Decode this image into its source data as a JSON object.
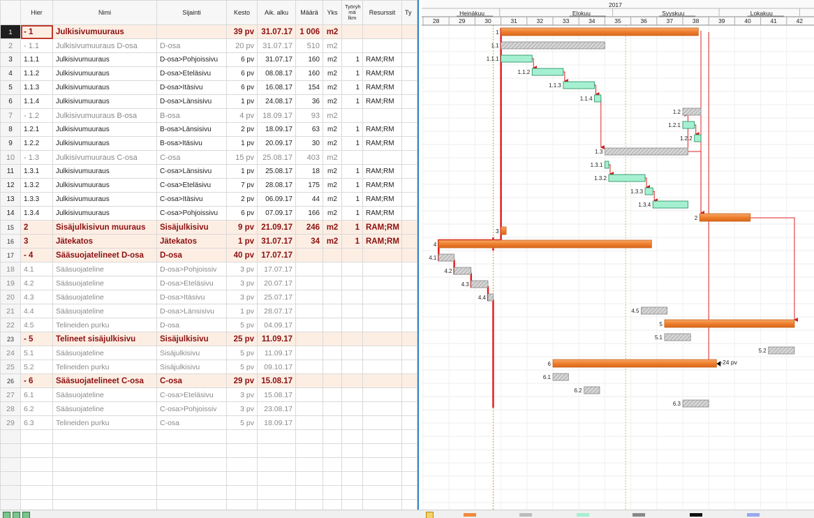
{
  "headers": {
    "hier": "Hier",
    "name": "Nimi",
    "location": "Sijainti",
    "duration": "Kesto",
    "start": "Aik. alku",
    "qty": "Määrä",
    "unit": "Yks",
    "crew": "Työryh\nmä\nlkm",
    "resources": "Resurssit",
    "type": "Ty"
  },
  "rows": [
    {
      "n": "1",
      "hier": "- 1",
      "name": "Julkisivumuuraus",
      "loc": "",
      "dur": "39 pv",
      "start": "31.07.17",
      "qty": "1 006",
      "unit": "m2",
      "crew": "",
      "res": "",
      "kind": "top",
      "sel": true
    },
    {
      "n": "2",
      "hier": "- 1.1",
      "name": "Julkisivumuuraus D-osa",
      "loc": "D-osa",
      "dur": "20 pv",
      "start": "31.07.17",
      "qty": "510",
      "unit": "m2",
      "crew": "",
      "res": "",
      "kind": "sum"
    },
    {
      "n": "3",
      "hier": "1.1.1",
      "name": "Julkisivumuuraus",
      "loc": "D-osa>Pohjoissivu",
      "dur": "6 pv",
      "start": "31.07.17",
      "qty": "160",
      "unit": "m2",
      "crew": "1",
      "res": "RAM;RM",
      "kind": "task"
    },
    {
      "n": "4",
      "hier": "1.1.2",
      "name": "Julkisivumuuraus",
      "loc": "D-osa>Eteläsivu",
      "dur": "6 pv",
      "start": "08.08.17",
      "qty": "160",
      "unit": "m2",
      "crew": "1",
      "res": "RAM;RM",
      "kind": "task"
    },
    {
      "n": "5",
      "hier": "1.1.3",
      "name": "Julkisivumuuraus",
      "loc": "D-osa>Itäsivu",
      "dur": "6 pv",
      "start": "16.08.17",
      "qty": "154",
      "unit": "m2",
      "crew": "1",
      "res": "RAM;RM",
      "kind": "task"
    },
    {
      "n": "6",
      "hier": "1.1.4",
      "name": "Julkisivumuuraus",
      "loc": "D-osa>Länsisivu",
      "dur": "1 pv",
      "start": "24.08.17",
      "qty": "36",
      "unit": "m2",
      "crew": "1",
      "res": "RAM;RM",
      "kind": "task"
    },
    {
      "n": "7",
      "hier": "- 1.2",
      "name": "Julkisivumuuraus B-osa",
      "loc": "B-osa",
      "dur": "4 pv",
      "start": "18.09.17",
      "qty": "93",
      "unit": "m2",
      "crew": "",
      "res": "",
      "kind": "sum"
    },
    {
      "n": "8",
      "hier": "1.2.1",
      "name": "Julkisivumuuraus",
      "loc": "B-osa>Länsisivu",
      "dur": "2 pv",
      "start": "18.09.17",
      "qty": "63",
      "unit": "m2",
      "crew": "1",
      "res": "RAM;RM",
      "kind": "task"
    },
    {
      "n": "9",
      "hier": "1.2.2",
      "name": "Julkisivumuuraus",
      "loc": "B-osa>Itäsivu",
      "dur": "1 pv",
      "start": "20.09.17",
      "qty": "30",
      "unit": "m2",
      "crew": "1",
      "res": "RAM;RM",
      "kind": "task"
    },
    {
      "n": "10",
      "hier": "- 1.3",
      "name": "Julkisivumuuraus C-osa",
      "loc": "C-osa",
      "dur": "15 pv",
      "start": "25.08.17",
      "qty": "403",
      "unit": "m2",
      "crew": "",
      "res": "",
      "kind": "sum"
    },
    {
      "n": "11",
      "hier": "1.3.1",
      "name": "Julkisivumuuraus",
      "loc": "C-osa>Länsisivu",
      "dur": "1 pv",
      "start": "25.08.17",
      "qty": "18",
      "unit": "m2",
      "crew": "1",
      "res": "RAM;RM",
      "kind": "task"
    },
    {
      "n": "12",
      "hier": "1.3.2",
      "name": "Julkisivumuuraus",
      "loc": "C-osa>Eteläsivu",
      "dur": "7 pv",
      "start": "28.08.17",
      "qty": "175",
      "unit": "m2",
      "crew": "1",
      "res": "RAM;RM",
      "kind": "task"
    },
    {
      "n": "13",
      "hier": "1.3.3",
      "name": "Julkisivumuuraus",
      "loc": "C-osa>Itäsivu",
      "dur": "2 pv",
      "start": "06.09.17",
      "qty": "44",
      "unit": "m2",
      "crew": "1",
      "res": "RAM;RM",
      "kind": "task"
    },
    {
      "n": "14",
      "hier": "1.3.4",
      "name": "Julkisivumuuraus",
      "loc": "C-osa>Pohjoissivu",
      "dur": "6 pv",
      "start": "07.09.17",
      "qty": "166",
      "unit": "m2",
      "crew": "1",
      "res": "RAM;RM",
      "kind": "task"
    },
    {
      "n": "15",
      "hier": "2",
      "name": "Sisäjulkisivun muuraus",
      "loc": "Sisäjulkisivu",
      "dur": "9 pv",
      "start": "21.09.17",
      "qty": "246",
      "unit": "m2",
      "crew": "1",
      "res": "RAM;RM",
      "kind": "top"
    },
    {
      "n": "16",
      "hier": "3",
      "name": "Jätekatos",
      "loc": "Jätekatos",
      "dur": "1 pv",
      "start": "31.07.17",
      "qty": "34",
      "unit": "m2",
      "crew": "1",
      "res": "RAM;RM",
      "kind": "top"
    },
    {
      "n": "17",
      "hier": "- 4",
      "name": "Sääsuojatelineet D-osa",
      "loc": "D-osa",
      "dur": "40 pv",
      "start": "17.07.17",
      "qty": "",
      "unit": "",
      "crew": "",
      "res": "",
      "kind": "top"
    },
    {
      "n": "18",
      "hier": "4.1",
      "name": "Sääsuojateline",
      "loc": "D-osa>Pohjoissiv",
      "dur": "3 pv",
      "start": "17.07.17",
      "qty": "",
      "unit": "",
      "crew": "",
      "res": "",
      "kind": "grey"
    },
    {
      "n": "19",
      "hier": "4.2",
      "name": "Sääsuojateline",
      "loc": "D-osa>Eteläsivu",
      "dur": "3 pv",
      "start": "20.07.17",
      "qty": "",
      "unit": "",
      "crew": "",
      "res": "",
      "kind": "grey"
    },
    {
      "n": "20",
      "hier": "4.3",
      "name": "Sääsuojateline",
      "loc": "D-osa>Itäsivu",
      "dur": "3 pv",
      "start": "25.07.17",
      "qty": "",
      "unit": "",
      "crew": "",
      "res": "",
      "kind": "grey"
    },
    {
      "n": "21",
      "hier": "4.4",
      "name": "Sääsuojateline",
      "loc": "D-osa>Länsisivu",
      "dur": "1 pv",
      "start": "28.07.17",
      "qty": "",
      "unit": "",
      "crew": "",
      "res": "",
      "kind": "grey"
    },
    {
      "n": "22",
      "hier": "4.5",
      "name": "Telineiden purku",
      "loc": "D-osa",
      "dur": "5 pv",
      "start": "04.09.17",
      "qty": "",
      "unit": "",
      "crew": "",
      "res": "",
      "kind": "grey"
    },
    {
      "n": "23",
      "hier": "- 5",
      "name": "Telineet sisäjulkisivu",
      "loc": "Sisäjulkisivu",
      "dur": "25 pv",
      "start": "11.09.17",
      "qty": "",
      "unit": "",
      "crew": "",
      "res": "",
      "kind": "top"
    },
    {
      "n": "24",
      "hier": "5.1",
      "name": "Sääsuojateline",
      "loc": "Sisäjulkisivu",
      "dur": "5 pv",
      "start": "11.09.17",
      "qty": "",
      "unit": "",
      "crew": "",
      "res": "",
      "kind": "grey"
    },
    {
      "n": "25",
      "hier": "5.2",
      "name": "Telineiden purku",
      "loc": "Sisäjulkisivu",
      "dur": "5 pv",
      "start": "09.10.17",
      "qty": "",
      "unit": "",
      "crew": "",
      "res": "",
      "kind": "grey"
    },
    {
      "n": "26",
      "hier": "- 6",
      "name": "Sääsuojatelineet C-osa",
      "loc": "C-osa",
      "dur": "29 pv",
      "start": "15.08.17",
      "qty": "",
      "unit": "",
      "crew": "",
      "res": "",
      "kind": "top"
    },
    {
      "n": "27",
      "hier": "6.1",
      "name": "Sääsuojateline",
      "loc": "C-osa>Eteläsivu",
      "dur": "3 pv",
      "start": "15.08.17",
      "qty": "",
      "unit": "",
      "crew": "",
      "res": "",
      "kind": "grey"
    },
    {
      "n": "28",
      "hier": "6.2",
      "name": "Sääsuojateline",
      "loc": "C-osa>Pohjoissiv",
      "dur": "3 pv",
      "start": "23.08.17",
      "qty": "",
      "unit": "",
      "crew": "",
      "res": "",
      "kind": "grey"
    },
    {
      "n": "29",
      "hier": "6.3",
      "name": "Telineiden purku",
      "loc": "C-osa",
      "dur": "5 pv",
      "start": "18.09.17",
      "qty": "",
      "unit": "",
      "crew": "",
      "res": "",
      "kind": "grey"
    }
  ],
  "timeline": {
    "year": "2017",
    "months": [
      "Heinäkuu",
      "Elokuu",
      "Syyskuu",
      "Lokakuu"
    ],
    "weeks": [
      "28",
      "29",
      "30",
      "31",
      "32",
      "33",
      "34",
      "35",
      "36",
      "37",
      "38",
      "39",
      "40",
      "41",
      "42"
    ]
  },
  "bars": [
    {
      "label": "1",
      "start": 3.0,
      "end": 10.6,
      "style": "orange"
    },
    {
      "label": "1.1",
      "start": 3.0,
      "end": 7.0,
      "style": "hatch"
    },
    {
      "label": "1.1.1",
      "start": 3.0,
      "end": 4.2,
      "style": "green"
    },
    {
      "label": "1.1.2",
      "start": 4.2,
      "end": 5.4,
      "style": "green"
    },
    {
      "label": "1.1.3",
      "start": 5.4,
      "end": 6.6,
      "style": "green"
    },
    {
      "label": "1.1.4",
      "start": 6.6,
      "end": 6.85,
      "style": "green"
    },
    {
      "label": "1.2",
      "start": 10.0,
      "end": 10.7,
      "style": "hatch"
    },
    {
      "label": "1.2.1",
      "start": 10.0,
      "end": 10.45,
      "style": "green"
    },
    {
      "label": "1.2.2",
      "start": 10.45,
      "end": 10.7,
      "style": "green"
    },
    {
      "label": "1.3",
      "start": 7.0,
      "end": 10.2,
      "style": "hatch"
    },
    {
      "label": "1.3.1",
      "start": 7.0,
      "end": 7.15,
      "style": "green"
    },
    {
      "label": "1.3.2",
      "start": 7.15,
      "end": 8.55,
      "style": "green"
    },
    {
      "label": "1.3.3",
      "start": 8.55,
      "end": 8.85,
      "style": "green"
    },
    {
      "label": "1.3.4",
      "start": 8.85,
      "end": 10.2,
      "style": "green"
    },
    {
      "label": "2",
      "start": 10.65,
      "end": 12.6,
      "style": "orange"
    },
    {
      "label": "3",
      "start": 3.0,
      "end": 3.2,
      "style": "orange"
    },
    {
      "label": "4",
      "start": 0.6,
      "end": 8.8,
      "style": "orange"
    },
    {
      "label": "4.1",
      "start": 0.6,
      "end": 1.2,
      "style": "hatch"
    },
    {
      "label": "4.2",
      "start": 1.2,
      "end": 1.85,
      "style": "hatch"
    },
    {
      "label": "4.3",
      "start": 1.85,
      "end": 2.5,
      "style": "hatch"
    },
    {
      "label": "4.4",
      "start": 2.5,
      "end": 2.7,
      "style": "hatch"
    },
    {
      "label": "4.5",
      "start": 8.4,
      "end": 9.4,
      "style": "hatch"
    },
    {
      "label": "5",
      "start": 9.3,
      "end": 14.3,
      "style": "orange"
    },
    {
      "label": "5.1",
      "start": 9.3,
      "end": 10.3,
      "style": "hatch"
    },
    {
      "label": "5.2",
      "start": 13.3,
      "end": 14.3,
      "style": "hatch"
    },
    {
      "label": "6",
      "start": 5.0,
      "end": 11.3,
      "style": "orange"
    },
    {
      "label": "6.1",
      "start": 5.0,
      "end": 5.6,
      "style": "hatch"
    },
    {
      "label": "6.2",
      "start": 6.2,
      "end": 6.8,
      "style": "hatch"
    },
    {
      "label": "6.3",
      "start": 10.0,
      "end": 11.0,
      "style": "hatch"
    }
  ],
  "annotation": "-24 pv",
  "colors": {
    "orange": "#f08a3c",
    "green": "#a6f0d2",
    "hatch": "#bdbdbd",
    "critical": "#e02020",
    "accent": "#2f83c9"
  }
}
